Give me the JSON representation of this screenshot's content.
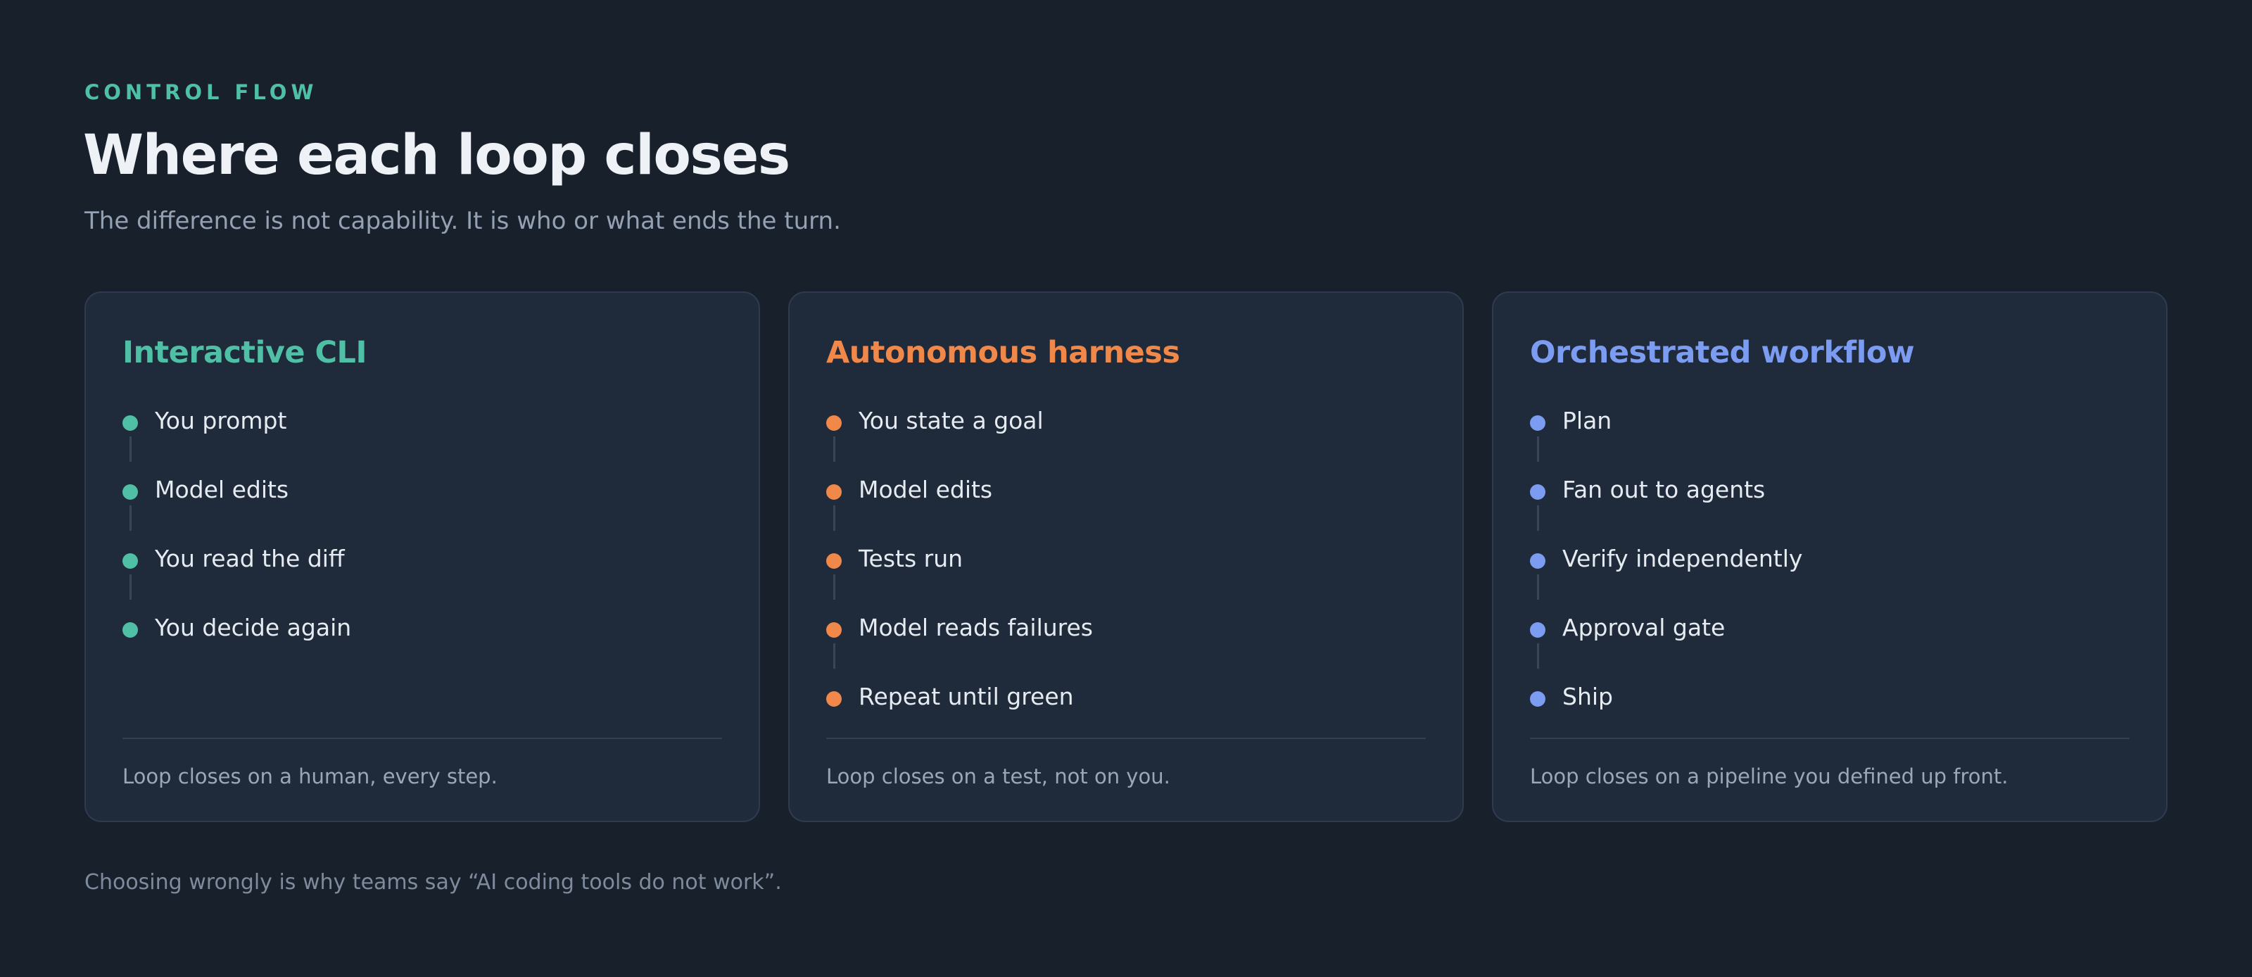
{
  "header": {
    "eyebrow": "CONTROL FLOW",
    "title": "Where each loop closes",
    "subtitle": "The difference is not capability. It is who or what ends the turn."
  },
  "colors": {
    "background": "#18202c",
    "card": "#1f2a3a",
    "teal": "#4fc0a6",
    "orange": "#f0884a",
    "blue": "#7b9cf0"
  },
  "cards": [
    {
      "title": "Interactive CLI",
      "accent": "#4fc0a6",
      "steps": [
        "You prompt",
        "Model edits",
        "You read the diff",
        "You decide again"
      ],
      "note": "Loop closes on a human, every step."
    },
    {
      "title": "Autonomous harness",
      "accent": "#f0884a",
      "steps": [
        "You state a goal",
        "Model edits",
        "Tests run",
        "Model reads failures",
        "Repeat until green"
      ],
      "note": "Loop closes on a test, not on you."
    },
    {
      "title": "Orchestrated workflow",
      "accent": "#7b9cf0",
      "steps": [
        "Plan",
        "Fan out to agents",
        "Verify independently",
        "Approval gate",
        "Ship"
      ],
      "note": "Loop closes on a pipeline you defined up front."
    }
  ],
  "footnote": "Choosing wrongly is why teams say “AI coding tools do not work”."
}
